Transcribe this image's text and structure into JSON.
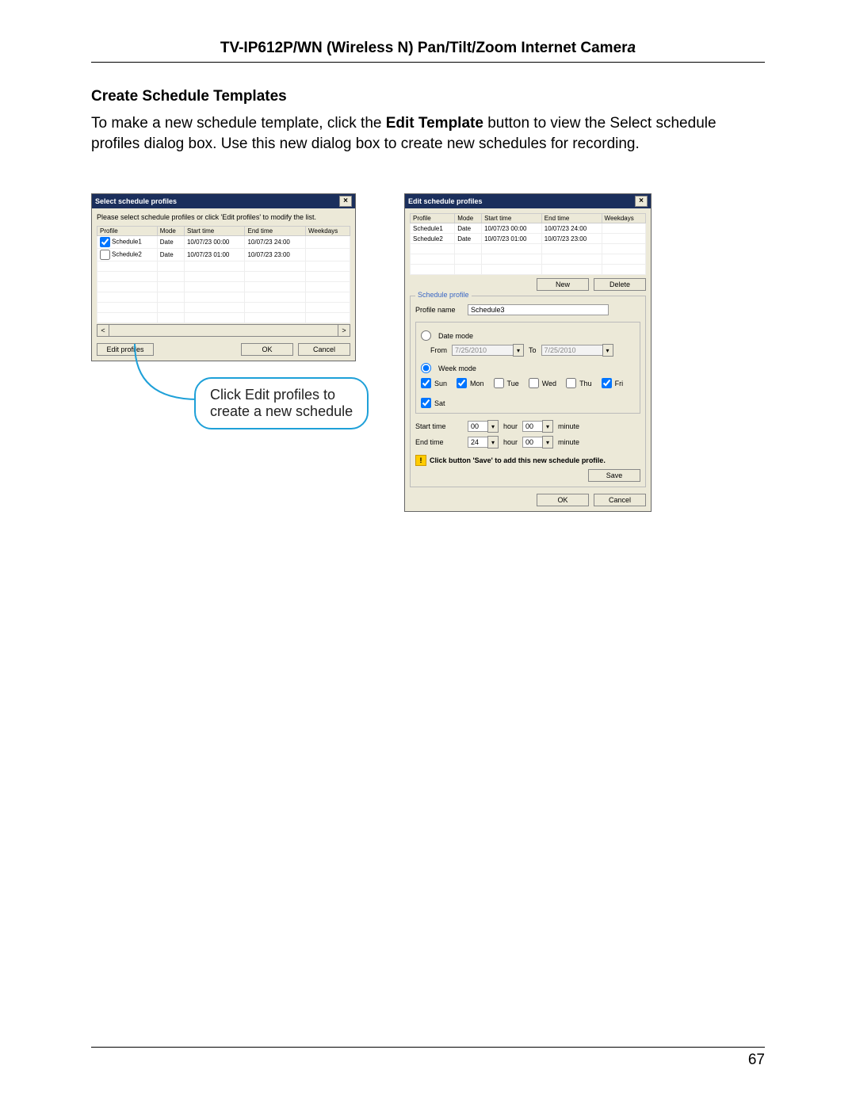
{
  "header": {
    "title_prefix": "TV-IP612P/WN (Wireless N) Pan/Tilt/Zoom Internet Camer",
    "title_italic": "a"
  },
  "section": {
    "heading": "Create Schedule Templates",
    "p1a": "To make a new schedule template, click the ",
    "p1b": "Edit Template",
    "p1c": " button to view the Select schedule profiles dialog box. Use this new dialog box to create new schedules for recording."
  },
  "callout": {
    "line1": "Click Edit profiles to",
    "line2": "create a new schedule"
  },
  "dlg1": {
    "title": "Select schedule profiles",
    "instruction": "Please select schedule profiles or click 'Edit profiles' to modify the list.",
    "cols": {
      "c1": "Profile",
      "c2": "Mode",
      "c3": "Start time",
      "c4": "End time",
      "c5": "Weekdays"
    },
    "rows": [
      {
        "name": "Schedule1",
        "mode": "Date",
        "start": "10/07/23 00:00",
        "end": "10/07/23 24:00",
        "wd": ""
      },
      {
        "name": "Schedule2",
        "mode": "Date",
        "start": "10/07/23 01:00",
        "end": "10/07/23 23:00",
        "wd": ""
      }
    ],
    "edit": "Edit profiles",
    "ok": "OK",
    "cancel": "Cancel"
  },
  "dlg2": {
    "title": "Edit schedule profiles",
    "cols": {
      "c1": "Profile",
      "c2": "Mode",
      "c3": "Start time",
      "c4": "End time",
      "c5": "Weekdays"
    },
    "rows": [
      {
        "name": "Schedule1",
        "mode": "Date",
        "start": "10/07/23 00:00",
        "end": "10/07/23 24:00",
        "wd": ""
      },
      {
        "name": "Schedule2",
        "mode": "Date",
        "start": "10/07/23 01:00",
        "end": "10/07/23 23:00",
        "wd": ""
      }
    ],
    "new": "New",
    "delete": "Delete",
    "legend": "Schedule profile",
    "profile_name_lab": "Profile name",
    "profile_name_val": "Schedule3",
    "date_mode": "Date mode",
    "from": "From",
    "from_val": "7/25/2010",
    "to": "To",
    "to_val": "7/25/2010",
    "week_mode": "Week mode",
    "days": {
      "sun": "Sun",
      "mon": "Mon",
      "tue": "Tue",
      "wed": "Wed",
      "thu": "Thu",
      "fri": "Fri",
      "sat": "Sat"
    },
    "start_lab": "Start time",
    "end_lab": "End time",
    "start_h": "00",
    "end_h": "24",
    "start_m": "00",
    "end_m": "00",
    "hour": "hour",
    "minute": "minute",
    "warn": "Click button 'Save' to add this new schedule profile.",
    "save": "Save",
    "ok": "OK",
    "cancel": "Cancel"
  },
  "footer": {
    "page": "67"
  }
}
